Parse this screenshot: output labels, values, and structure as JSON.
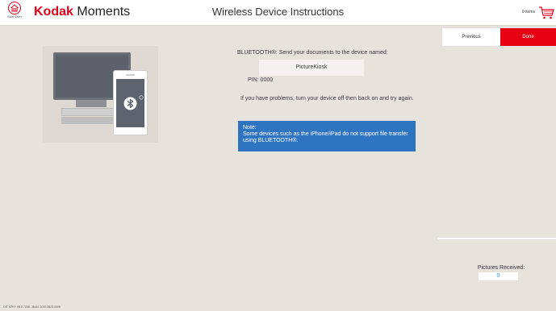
{
  "header": {
    "home_label": "Start Over",
    "brand_kodak": "Kodak",
    "brand_moments": "Moments",
    "title": "Wireless Device Instructions",
    "cart_count": "0 items",
    "accent_color": "#e2001a"
  },
  "instructions": {
    "bluetooth_line": "BLUETOOTH®: Send your documents to the device named:",
    "device_name": "PictureKiosk",
    "pin": "PIN: 0000",
    "problems": "If you have problems, turn your device off then back on and try again."
  },
  "note": {
    "heading": "Note:",
    "text": "Some devices such as the iPhone/iPad do not support file transfer using BLUETOOTH®."
  },
  "buttons": {
    "previous": "Previous",
    "done": "Done"
  },
  "received": {
    "label": "Pictures Received:",
    "value": "0"
  },
  "footer": {
    "version": "OIT KPK+ V8.0.7296 - Build: 2019.0623.0005"
  },
  "icons": [
    "home-icon",
    "cart-icon",
    "bluetooth-icon",
    "monitor-illustration",
    "phone-illustration"
  ]
}
